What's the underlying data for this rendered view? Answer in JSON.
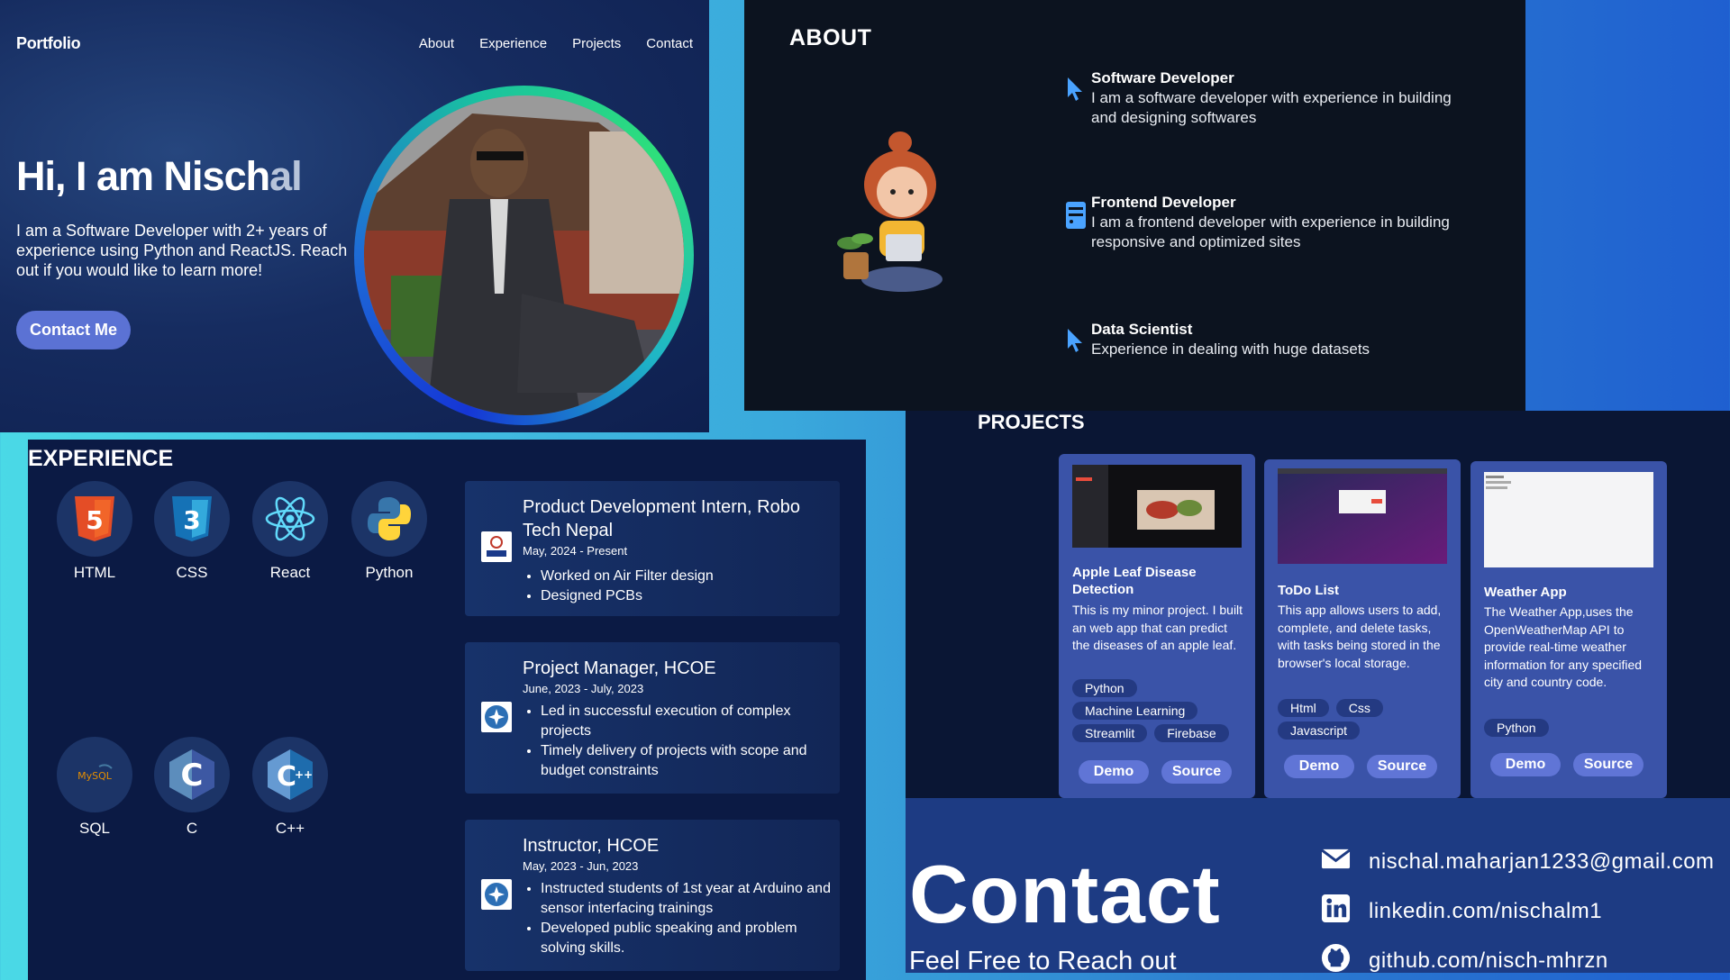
{
  "hero": {
    "logo": "Portfolio",
    "nav": [
      "About",
      "Experience",
      "Projects",
      "Contact"
    ],
    "title_main": "Hi, I am Nisch",
    "title_fade": "al",
    "text": "I am a Software Developer with 2+ years of experience using Python and ReactJS. Reach out if you would like to learn more!",
    "cta": "Contact Me"
  },
  "about": {
    "title": "ABOUT",
    "items": [
      {
        "heading": "Software Developer",
        "text": "I am a software developer with experience in building and designing softwares",
        "icon": "cursor-icon"
      },
      {
        "heading": "Frontend Developer",
        "text": "I am a frontend developer with experience in building responsive and optimized sites",
        "icon": "server-icon"
      },
      {
        "heading": "Data Scientist",
        "text": "Experience in dealing with huge datasets",
        "icon": "cursor-icon"
      }
    ]
  },
  "experience": {
    "title": "EXPERIENCE",
    "skills": [
      "HTML",
      "CSS",
      "React",
      "Python",
      "SQL",
      "C",
      "C++"
    ],
    "jobs": [
      {
        "title": "Product Development Intern, Robo Tech Nepal",
        "date": "May, 2024 - Present",
        "bullets": [
          "Worked on Air Filter design",
          "Designed PCBs"
        ]
      },
      {
        "title": "Project Manager, HCOE",
        "date": "June, 2023 - July, 2023",
        "bullets": [
          "Led in successful execution of complex projects",
          "Timely delivery of projects with scope and budget constraints"
        ]
      },
      {
        "title": "Instructor, HCOE",
        "date": "May, 2023 - Jun, 2023",
        "bullets": [
          "Instructed students of 1st year at Arduino and sensor interfacing trainings",
          "Developed public speaking and problem solving skills."
        ]
      }
    ]
  },
  "projects": {
    "title": "PROJECTS",
    "cards": [
      {
        "title": "Apple Leaf Disease Detection",
        "desc": "This is my minor project. I built an web app that can predict the diseases of an apple leaf.",
        "tags": [
          "Python",
          "Machine Learning",
          "Streamlit",
          "Firebase"
        ],
        "demo": "Demo",
        "source": "Source"
      },
      {
        "title": "ToDo List",
        "desc": "This app allows users to add, complete, and delete tasks, with tasks being stored in the browser's local storage.",
        "tags": [
          "Html",
          "Css",
          "Javascript"
        ],
        "demo": "Demo",
        "source": "Source"
      },
      {
        "title": "Weather App",
        "desc": "The Weather App,uses the OpenWeatherMap API to provide real-time weather information for any specified city and country code.",
        "tags": [
          "Python"
        ],
        "demo": "Demo",
        "source": "Source"
      }
    ]
  },
  "contact": {
    "title": "Contact",
    "subtitle": "Feel Free to Reach out",
    "email": "nischal.maharjan1233@gmail.com",
    "linkedin": "linkedin.com/nischalm1",
    "github": "github.com/nisch-mhrzn"
  }
}
